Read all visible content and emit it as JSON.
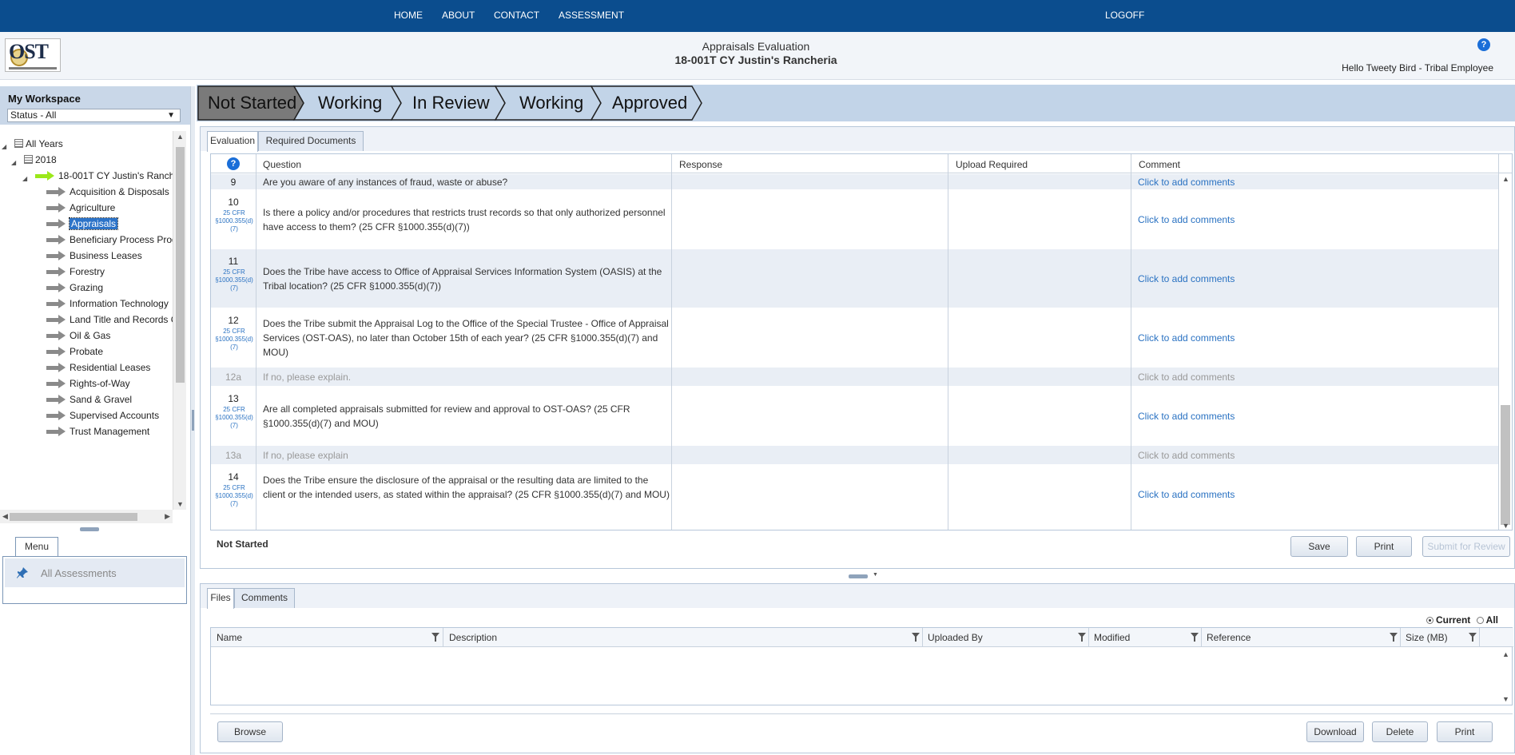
{
  "nav": {
    "home": "HOME",
    "about": "ABOUT",
    "contact": "CONTACT",
    "assessment": "ASSESSMENT",
    "logoff": "LOGOFF"
  },
  "header": {
    "logo_text": "OST",
    "title": "Appraisals Evaluation",
    "subtitle": "18-001T CY Justin's Rancheria",
    "help_icon": "?",
    "greeting": "Hello Tweety Bird - Tribal Employee"
  },
  "workspace": {
    "title": "My Workspace",
    "status_filter": "Status - All",
    "tree": {
      "all_years": "All Years",
      "year": "2018",
      "assessment": "18-001T CY Justin's Ranch",
      "items": [
        "Acquisition & Disposals",
        "Agriculture",
        "Appraisals",
        "Beneficiary Process Prog",
        "Business Leases",
        "Forestry",
        "Grazing",
        "Information Technology",
        "Land Title and Records C",
        "Oil & Gas",
        "Probate",
        "Residential Leases",
        "Rights-of-Way",
        "Sand & Gravel",
        "Supervised Accounts",
        "Trust Management"
      ],
      "selected_index": 2
    },
    "menu": {
      "tab": "Menu",
      "item": "All Assessments"
    }
  },
  "workflow": {
    "steps": [
      "Not Started",
      "Working",
      "In Review",
      "Working",
      "Approved"
    ],
    "current_index": 0,
    "colors": {
      "active": "#7a7a7a",
      "inactive": "#c2d4e8"
    }
  },
  "evaluation": {
    "tabs": [
      "Evaluation",
      "Required Documents"
    ],
    "active_tab": 0,
    "columns": {
      "help": "?",
      "question": "Question",
      "response": "Response",
      "upload": "Upload Required",
      "comment": "Comment"
    },
    "rows": [
      {
        "num": "9",
        "cfr": "",
        "question": "Are you aware of any instances of fraud, waste or abuse?",
        "comment": "Click to add comments",
        "sub": false
      },
      {
        "num": "10",
        "cfr": "25 CFR §1000.355(d)(7)",
        "question": "Is there a policy and/or procedures that restricts trust records so that only authorized personnel have access to them? (25 CFR §1000.355(d)(7))",
        "comment": "Click to add comments",
        "sub": false
      },
      {
        "num": "11",
        "cfr": "25 CFR §1000.355(d)(7)",
        "question": "Does the Tribe have access to Office of Appraisal Services Information System (OASIS) at the Tribal location? (25 CFR §1000.355(d)(7))",
        "comment": "Click to add comments",
        "sub": false
      },
      {
        "num": "12",
        "cfr": "25 CFR §1000.355(d)(7)",
        "question": "Does the Tribe submit the Appraisal Log to the Office of the Special Trustee - Office of Appraisal Services (OST-OAS), no later than October 15th of each year? (25 CFR §1000.355(d)(7) and MOU)",
        "comment": "Click to add comments",
        "sub": false
      },
      {
        "num": "12a",
        "cfr": "",
        "question": "If no, please explain.",
        "comment": "Click to add comments",
        "sub": true
      },
      {
        "num": "13",
        "cfr": "25 CFR §1000.355(d)(7)",
        "question": "Are all completed appraisals submitted for review and approval to OST-OAS? (25 CFR §1000.355(d)(7) and MOU)",
        "comment": "Click to add comments",
        "sub": false
      },
      {
        "num": "13a",
        "cfr": "",
        "question": "If no, please explain",
        "comment": "Click to add comments",
        "sub": true
      },
      {
        "num": "14",
        "cfr": "25 CFR §1000.355(d)(7)",
        "question": "Does the Tribe ensure the disclosure of the appraisal or the resulting data are limited to the client or the intended users, as stated within the appraisal? (25 CFR §1000.355(d)(7) and MOU)",
        "comment": "Click to add comments",
        "sub": false
      }
    ],
    "status": "Not Started",
    "buttons": {
      "save": "Save",
      "print": "Print",
      "submit": "Submit for Review"
    }
  },
  "files": {
    "tabs": [
      "Files",
      "Comments"
    ],
    "active_tab": 0,
    "filter": {
      "current": "Current",
      "all": "All",
      "selected": "current"
    },
    "columns": [
      "Name",
      "Description",
      "Uploaded By",
      "Modified",
      "Reference",
      "Size (MB)"
    ],
    "buttons": {
      "browse": "Browse",
      "download": "Download",
      "delete": "Delete",
      "print": "Print"
    }
  }
}
